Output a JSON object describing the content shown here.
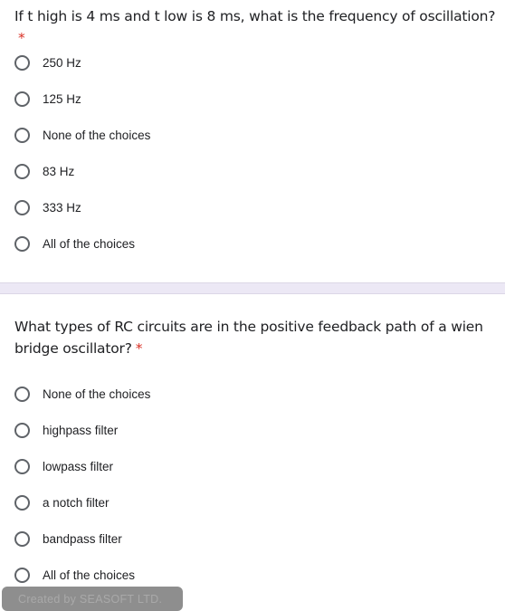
{
  "question1": {
    "title": "If t high is 4 ms and t low is 8 ms, what is the frequency of oscillation?",
    "required_marker": "*",
    "options": [
      "250 Hz",
      "125 Hz",
      "None of the choices",
      "83 Hz",
      "333 Hz",
      "All of the choices"
    ]
  },
  "question2": {
    "title": "What types of RC circuits are in the positive feedback path of a wien bridge oscillator?",
    "required_marker": "*",
    "options": [
      "None of the choices",
      "highpass filter",
      "lowpass filter",
      "a notch filter",
      "bandpass filter",
      "All of the choices"
    ]
  },
  "watermark": "Created by SEASOFT LTD.",
  "colors": {
    "required": "#d93025",
    "divider": "#ece8f5",
    "radio_border": "#5f6368"
  }
}
